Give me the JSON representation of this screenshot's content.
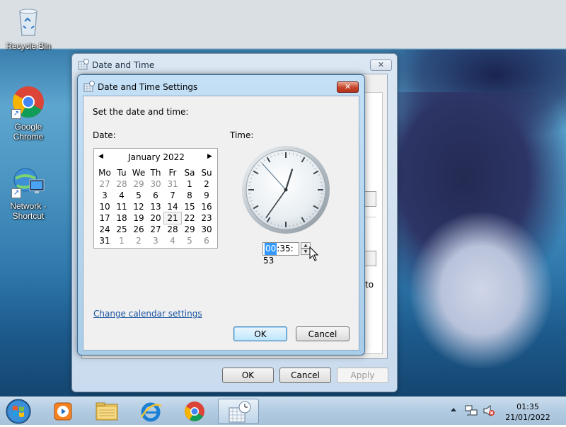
{
  "desktop": {
    "icons": [
      {
        "label": "Recycle Bin"
      },
      {
        "label": "Google Chrome"
      },
      {
        "label": "Network - Shortcut"
      }
    ]
  },
  "outer_dialog": {
    "title": "Date and Time",
    "close_glyph": "✕",
    "buttons": {
      "ok": "OK",
      "cancel": "Cancel",
      "apply": "Apply"
    },
    "partial_text": "to"
  },
  "inner_dialog": {
    "title": "Date and Time Settings",
    "close_glyph": "✕",
    "instruction": "Set the date and time:",
    "date_label": "Date:",
    "time_label": "Time:",
    "calendar": {
      "month_title": "January 2022",
      "prev_glyph": "◀",
      "next_glyph": "▶",
      "weekdays": [
        "Mo",
        "Tu",
        "We",
        "Th",
        "Fr",
        "Sa",
        "Su"
      ],
      "weeks": [
        [
          {
            "d": "27",
            "o": true
          },
          {
            "d": "28",
            "o": true
          },
          {
            "d": "29",
            "o": true
          },
          {
            "d": "30",
            "o": true
          },
          {
            "d": "31",
            "o": true
          },
          {
            "d": "1"
          },
          {
            "d": "2"
          }
        ],
        [
          {
            "d": "3"
          },
          {
            "d": "4"
          },
          {
            "d": "5"
          },
          {
            "d": "6"
          },
          {
            "d": "7"
          },
          {
            "d": "8"
          },
          {
            "d": "9"
          }
        ],
        [
          {
            "d": "10"
          },
          {
            "d": "11"
          },
          {
            "d": "12"
          },
          {
            "d": "13"
          },
          {
            "d": "14"
          },
          {
            "d": "15"
          },
          {
            "d": "16"
          }
        ],
        [
          {
            "d": "17"
          },
          {
            "d": "18"
          },
          {
            "d": "19"
          },
          {
            "d": "20"
          },
          {
            "d": "21",
            "sel": true
          },
          {
            "d": "22"
          },
          {
            "d": "23"
          }
        ],
        [
          {
            "d": "24"
          },
          {
            "d": "25"
          },
          {
            "d": "26"
          },
          {
            "d": "27"
          },
          {
            "d": "28"
          },
          {
            "d": "29"
          },
          {
            "d": "30"
          }
        ],
        [
          {
            "d": "31"
          },
          {
            "d": "1",
            "o": true
          },
          {
            "d": "2",
            "o": true
          },
          {
            "d": "3",
            "o": true
          },
          {
            "d": "4",
            "o": true
          },
          {
            "d": "5",
            "o": true
          },
          {
            "d": "6",
            "o": true
          }
        ]
      ]
    },
    "time": {
      "hours": "00",
      "sep1": ":",
      "minutes": "35",
      "sep2": ":",
      "seconds": "53"
    },
    "clock": {
      "hour": 0,
      "minute": 35,
      "second": 53
    },
    "change_calendar_link": "Change calendar settings",
    "buttons": {
      "ok": "OK",
      "cancel": "Cancel"
    }
  },
  "taskbar": {
    "clock_time": "01:35",
    "clock_date": "21/01/2022",
    "apps": [
      "media-player-icon",
      "file-explorer-icon",
      "internet-explorer-icon",
      "chrome-icon",
      "date-time-icon"
    ],
    "tray_icons": [
      "show-hidden-icons-icon",
      "network-icon",
      "volume-muted-icon"
    ]
  }
}
